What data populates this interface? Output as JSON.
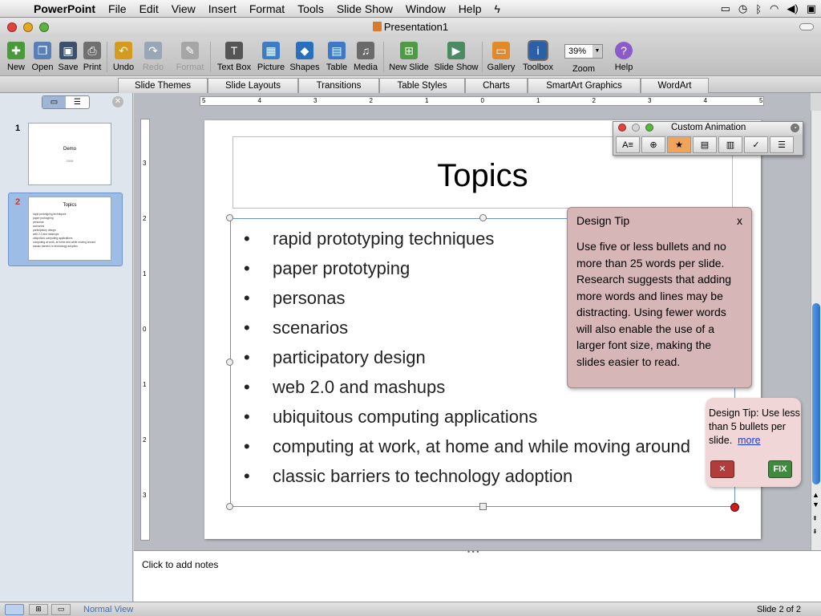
{
  "menubar": {
    "app": "PowerPoint",
    "items": [
      "File",
      "Edit",
      "View",
      "Insert",
      "Format",
      "Tools",
      "Slide Show",
      "Window",
      "Help"
    ]
  },
  "window": {
    "title": "Presentation1"
  },
  "toolbar": {
    "buttons": [
      {
        "label": "New",
        "color": "#4a9a3b"
      },
      {
        "label": "Open",
        "color": "#5b7fb5"
      },
      {
        "label": "Save",
        "color": "#3c4f6b"
      },
      {
        "label": "Print",
        "color": "#707070"
      },
      {
        "label": "Undo",
        "color": "#d69a1f"
      },
      {
        "label": "Redo",
        "color": "#9aa6b5"
      },
      {
        "label": "Format",
        "color": "#a6a6a6"
      },
      {
        "label": "Text Box",
        "color": "#555555"
      },
      {
        "label": "Picture",
        "color": "#3e7cc4"
      },
      {
        "label": "Shapes",
        "color": "#2a6fbe"
      },
      {
        "label": "Table",
        "color": "#3f78c9"
      },
      {
        "label": "Media",
        "color": "#6a6a6a"
      },
      {
        "label": "New Slide",
        "color": "#4f9a46"
      },
      {
        "label": "Slide Show",
        "color": "#4a8b62"
      },
      {
        "label": "Gallery",
        "color": "#e08a2a"
      },
      {
        "label": "Toolbox",
        "color": "#2b5fa8"
      },
      {
        "label": "Zoom",
        "color": "#ffffff"
      },
      {
        "label": "Help",
        "color": "#8b5cc9"
      }
    ],
    "zoom_value": "39%"
  },
  "ribbon": {
    "tabs": [
      "Slide Themes",
      "Slide Layouts",
      "Transitions",
      "Table Styles",
      "Charts",
      "SmartArt Graphics",
      "WordArt"
    ]
  },
  "slides_pane": {
    "slides": [
      {
        "number": "1",
        "title": "Demo",
        "subtitle": "2008"
      },
      {
        "number": "2",
        "title": "Topics"
      }
    ]
  },
  "ruler": {
    "h_labels": [
      "5",
      "4",
      "3",
      "2",
      "1",
      "0",
      "1",
      "2",
      "3",
      "4",
      "5"
    ],
    "v_labels": [
      "3",
      "2",
      "1",
      "0",
      "1",
      "2",
      "3"
    ]
  },
  "slide": {
    "title": "Topics",
    "bullets": [
      "rapid prototyping techniques",
      "paper prototyping",
      "personas",
      "scenarios",
      "participatory design",
      "web 2.0 and mashups",
      "ubiquitous computing applications",
      "computing at work, at home and while moving around",
      "classic barriers to technology adoption"
    ]
  },
  "custom_animation": {
    "title": "Custom Animation"
  },
  "design_tip": {
    "title": "Design Tip",
    "close": "x",
    "body": "Use five or less bullets and no more than 25 words per slide. Research suggests that adding more words and lines may be distracting. Using fewer words will also enable the use of a larger font size, making the slides easier to read."
  },
  "tip_bubble": {
    "text": "Design Tip:  Use less than 5 bullets per slide.",
    "link": "more",
    "dismiss": "✕",
    "fix": "FIX"
  },
  "notes": {
    "placeholder": "Click to add notes"
  },
  "status": {
    "view": "Normal View",
    "slide_position": "Slide 2 of 2"
  }
}
